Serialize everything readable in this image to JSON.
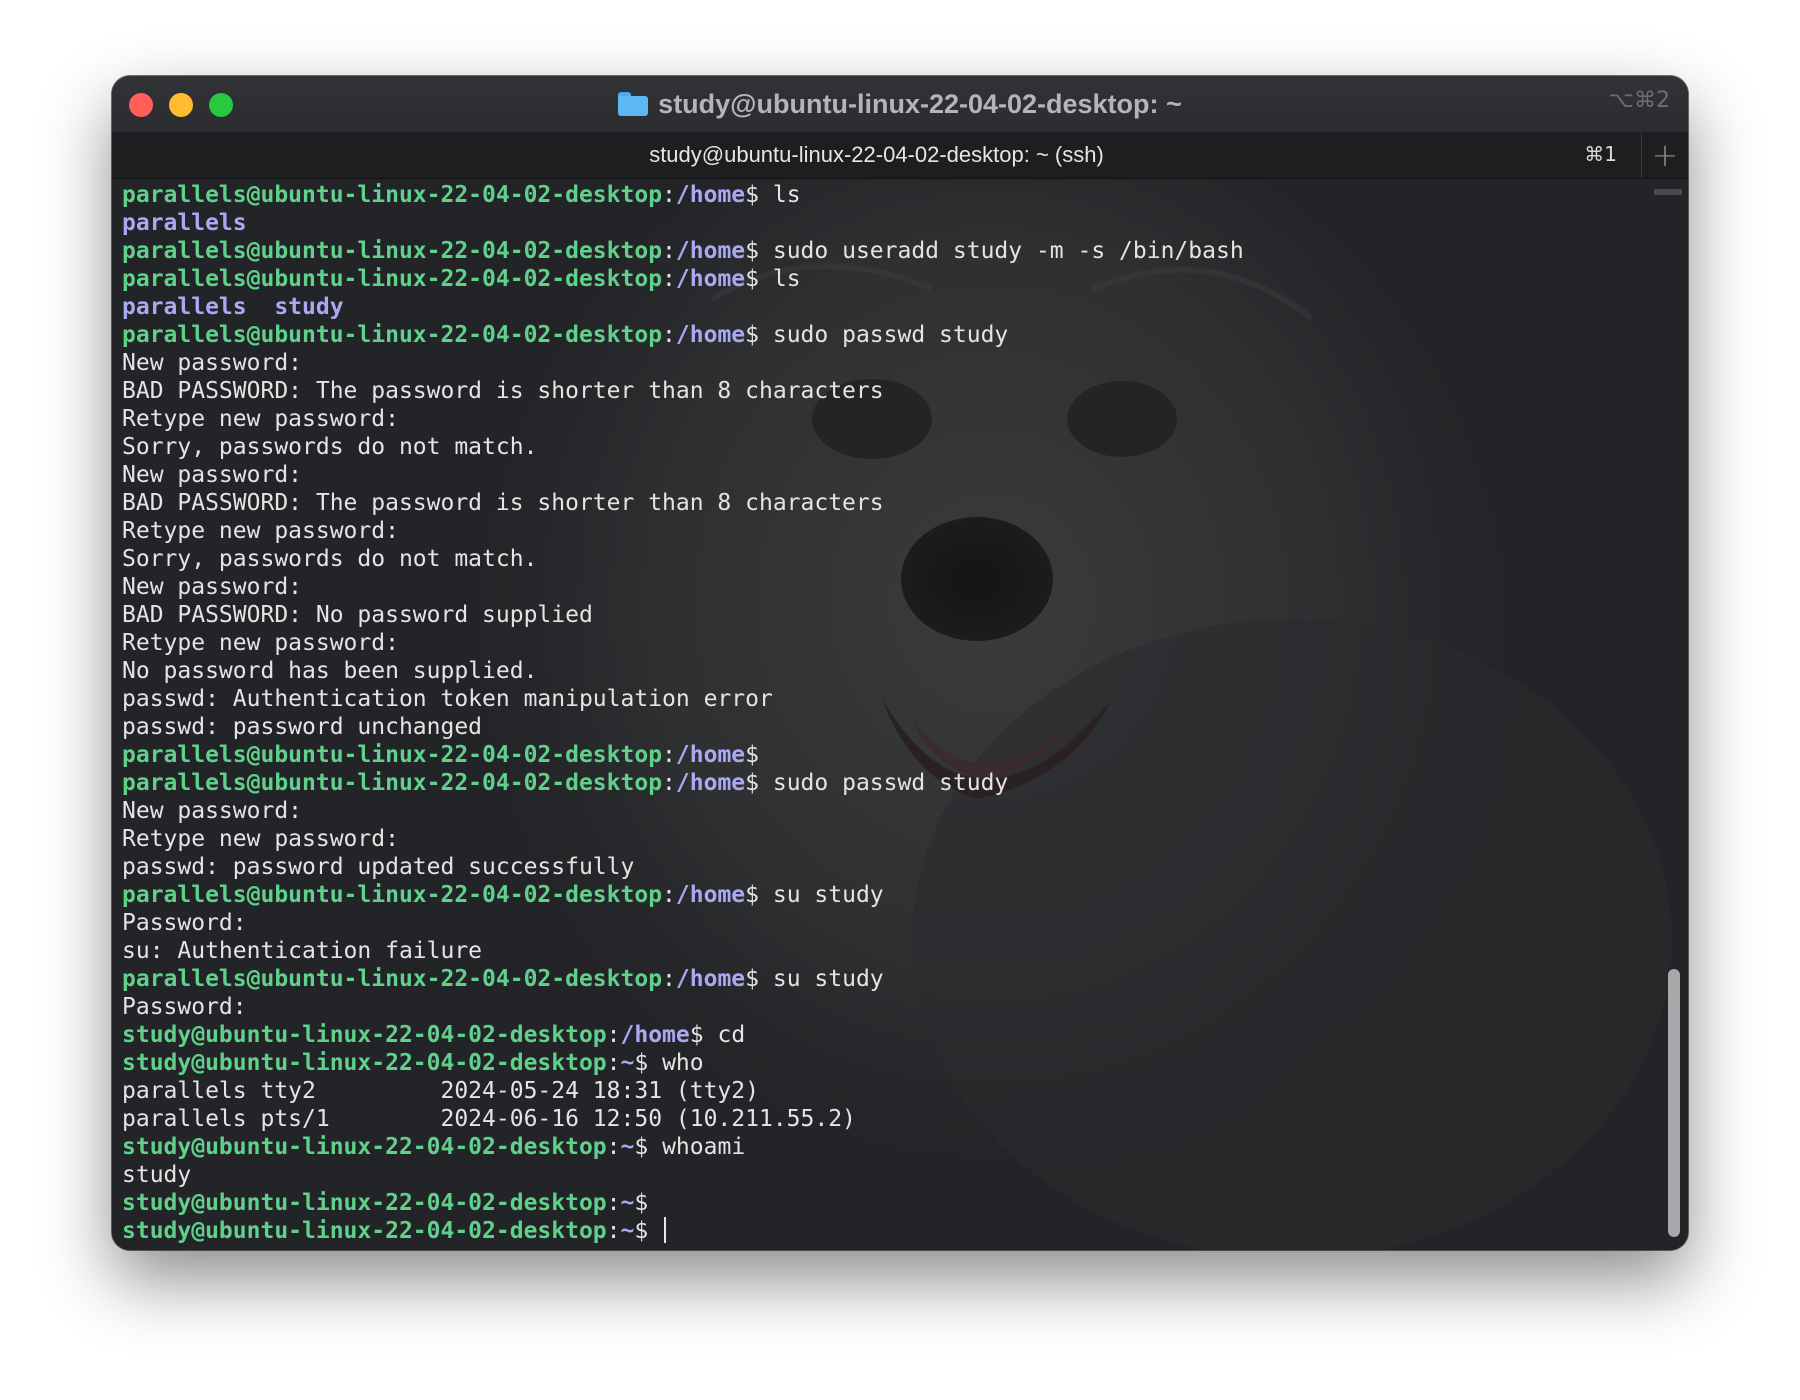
{
  "window": {
    "title": "study@ubuntu-linux-22-04-02-desktop: ~",
    "window_shortcut": "⌥⌘2",
    "icons": {
      "folder": "folder-icon",
      "new_tab": "plus-icon"
    }
  },
  "tabs": [
    {
      "label": "study@ubuntu-linux-22-04-02-desktop: ~ (ssh)",
      "shortcut": "⌘1",
      "active": true
    }
  ],
  "new_tab_label": "+",
  "colors": {
    "prompt_user": "#5fd18a",
    "prompt_path": "#a9a9f3",
    "text": "#e4e4e4",
    "background": "#232427",
    "close": "#ff5f57",
    "minimize": "#febc2e",
    "zoom": "#28c840"
  },
  "terminal": {
    "lines": [
      {
        "type": "prompt",
        "user": "parallels@ubuntu-linux-22-04-02-desktop",
        "sep": ":",
        "path": "/home",
        "sym": "$ ",
        "cmd": "ls"
      },
      {
        "type": "dirs",
        "text": "parallels"
      },
      {
        "type": "prompt",
        "user": "parallels@ubuntu-linux-22-04-02-desktop",
        "sep": ":",
        "path": "/home",
        "sym": "$ ",
        "cmd": "sudo useradd study -m -s /bin/bash"
      },
      {
        "type": "prompt",
        "user": "parallels@ubuntu-linux-22-04-02-desktop",
        "sep": ":",
        "path": "/home",
        "sym": "$ ",
        "cmd": "ls"
      },
      {
        "type": "dirs",
        "text": "parallels  study"
      },
      {
        "type": "prompt",
        "user": "parallels@ubuntu-linux-22-04-02-desktop",
        "sep": ":",
        "path": "/home",
        "sym": "$ ",
        "cmd": "sudo passwd study"
      },
      {
        "type": "output",
        "text": "New password:"
      },
      {
        "type": "output",
        "text": "BAD PASSWORD: The password is shorter than 8 characters"
      },
      {
        "type": "output",
        "text": "Retype new password:"
      },
      {
        "type": "output",
        "text": "Sorry, passwords do not match."
      },
      {
        "type": "output",
        "text": "New password:"
      },
      {
        "type": "output",
        "text": "BAD PASSWORD: The password is shorter than 8 characters"
      },
      {
        "type": "output",
        "text": "Retype new password:"
      },
      {
        "type": "output",
        "text": "Sorry, passwords do not match."
      },
      {
        "type": "output",
        "text": "New password:"
      },
      {
        "type": "output",
        "text": "BAD PASSWORD: No password supplied"
      },
      {
        "type": "output",
        "text": "Retype new password:"
      },
      {
        "type": "output",
        "text": "No password has been supplied."
      },
      {
        "type": "output",
        "text": "passwd: Authentication token manipulation error"
      },
      {
        "type": "output",
        "text": "passwd: password unchanged"
      },
      {
        "type": "prompt",
        "user": "parallels@ubuntu-linux-22-04-02-desktop",
        "sep": ":",
        "path": "/home",
        "sym": "$",
        "cmd": ""
      },
      {
        "type": "prompt",
        "user": "parallels@ubuntu-linux-22-04-02-desktop",
        "sep": ":",
        "path": "/home",
        "sym": "$ ",
        "cmd": "sudo passwd study"
      },
      {
        "type": "output",
        "text": "New password:"
      },
      {
        "type": "output",
        "text": "Retype new password:"
      },
      {
        "type": "output",
        "text": "passwd: password updated successfully"
      },
      {
        "type": "prompt",
        "user": "parallels@ubuntu-linux-22-04-02-desktop",
        "sep": ":",
        "path": "/home",
        "sym": "$ ",
        "cmd": "su study"
      },
      {
        "type": "output",
        "text": "Password:"
      },
      {
        "type": "output",
        "text": "su: Authentication failure"
      },
      {
        "type": "prompt",
        "user": "parallels@ubuntu-linux-22-04-02-desktop",
        "sep": ":",
        "path": "/home",
        "sym": "$ ",
        "cmd": "su study"
      },
      {
        "type": "output",
        "text": "Password:"
      },
      {
        "type": "prompt",
        "user": "study@ubuntu-linux-22-04-02-desktop",
        "sep": ":",
        "path": "/home",
        "sym": "$ ",
        "cmd": "cd"
      },
      {
        "type": "prompt",
        "user": "study@ubuntu-linux-22-04-02-desktop",
        "sep": ":",
        "path": "~",
        "sym": "$ ",
        "cmd": "who"
      },
      {
        "type": "output",
        "text": "parallels tty2         2024-05-24 18:31 (tty2)"
      },
      {
        "type": "output",
        "text": "parallels pts/1        2024-06-16 12:50 (10.211.55.2)"
      },
      {
        "type": "prompt",
        "user": "study@ubuntu-linux-22-04-02-desktop",
        "sep": ":",
        "path": "~",
        "sym": "$ ",
        "cmd": "whoami"
      },
      {
        "type": "output",
        "text": "study"
      },
      {
        "type": "prompt",
        "user": "study@ubuntu-linux-22-04-02-desktop",
        "sep": ":",
        "path": "~",
        "sym": "$",
        "cmd": ""
      },
      {
        "type": "prompt",
        "user": "study@ubuntu-linux-22-04-02-desktop",
        "sep": ":",
        "path": "~",
        "sym": "$ ",
        "cmd": "",
        "cursor": true
      }
    ]
  }
}
